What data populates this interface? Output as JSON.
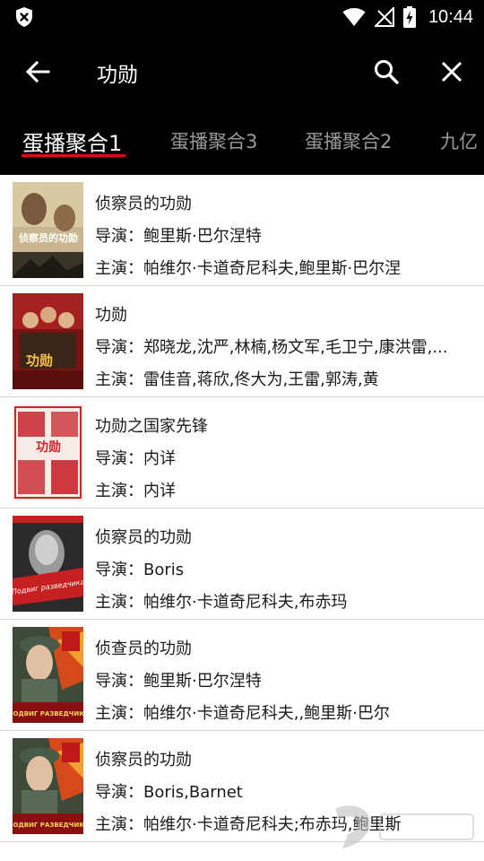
{
  "status_bar": {
    "time": "10:44",
    "left_icon": "shield-x-icon",
    "icons": [
      "wifi-icon",
      "no-signal-icon",
      "battery-charging-icon"
    ]
  },
  "app_bar": {
    "search_query": "功勋",
    "back_icon": "back-arrow-icon",
    "search_icon": "search-icon",
    "close_icon": "close-icon"
  },
  "tabs": [
    {
      "label": "蛋播聚合1",
      "active": true
    },
    {
      "label": "蛋播聚合3",
      "active": false
    },
    {
      "label": "蛋播聚合2",
      "active": false
    },
    {
      "label": "九亿",
      "active": false
    }
  ],
  "results": [
    {
      "title": "侦察员的功勋",
      "director_prefix": "导演：",
      "director": "鲍里斯·巴尔涅特",
      "cast_prefix": "主演：",
      "cast": "帕维尔·卡道奇尼科夫,鲍里斯·巴尔涅",
      "poster_text": "侦察员的功勋"
    },
    {
      "title": "功勋",
      "director_prefix": "导演：",
      "director": "郑晓龙,沈严,林楠,杨文军,毛卫宁,康洪雷,...",
      "cast_prefix": "主演：",
      "cast": "雷佳音,蒋欣,佟大为,王雷,郭涛,黄",
      "poster_text": "功勋"
    },
    {
      "title": "功勋之国家先锋",
      "director_prefix": "导演：",
      "director": "内详",
      "cast_prefix": "主演：",
      "cast": "内详",
      "poster_text": "功勋"
    },
    {
      "title": "侦察员的功勋",
      "director_prefix": "导演：",
      "director": "Boris",
      "cast_prefix": "主演：",
      "cast": "帕维尔·卡道奇尼科夫,布赤玛",
      "poster_text": "Подвиг разведчика"
    },
    {
      "title": "侦查员的功勋",
      "director_prefix": "导演：",
      "director": "鲍里斯·巴尔涅特",
      "cast_prefix": "主演：",
      "cast": "帕维尔·卡道奇尼科夫,,鲍里斯·巴尔",
      "poster_text": "ПОДВИГ РАЗВЕДЧИКА"
    },
    {
      "title": "侦察员的功勋",
      "director_prefix": "导演：",
      "director": "Boris,Barnet",
      "cast_prefix": "主演：",
      "cast": "帕维尔·卡道奇尼科夫;布赤玛,鲍里斯",
      "poster_text": "ПОДВИГ РАЗВЕДЧИКА"
    }
  ],
  "colors": {
    "header_bg": "#000000",
    "tab_indicator": "#e50914",
    "tab_inactive": "#9a9a9a",
    "list_bg": "#ffffff",
    "divider": "#d7d7d7"
  }
}
